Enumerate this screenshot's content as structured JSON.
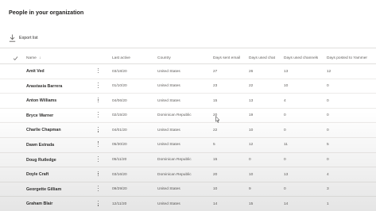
{
  "page": {
    "title": "People in your organization"
  },
  "toolbar": {
    "export_label": "Export list"
  },
  "table": {
    "columns": {
      "name": "Name",
      "last_active": "Last active",
      "country": "Country",
      "days_email": "Days sent email",
      "days_chat": "Days used chat",
      "days_channels": "Days used channels",
      "days_yammer": "Days posted to Yammer"
    },
    "rows": [
      {
        "name": "Amit Ved",
        "last_active": "03/18/20",
        "country": "United States",
        "email": "27",
        "chat": "26",
        "channels": "13",
        "yammer": "12"
      },
      {
        "name": "Anastasia Barrera",
        "last_active": "01/10/20",
        "country": "United States",
        "email": "23",
        "chat": "22",
        "channels": "10",
        "yammer": "0"
      },
      {
        "name": "Anton Williams",
        "last_active": "04/06/20",
        "country": "United States",
        "email": "15",
        "chat": "13",
        "channels": "4",
        "yammer": "0"
      },
      {
        "name": "Bryce Warner",
        "last_active": "02/15/20",
        "country": "Dominican Republic",
        "email": "20",
        "chat": "19",
        "channels": "0",
        "yammer": "0"
      },
      {
        "name": "Charlie Chapman",
        "last_active": "04/01/20",
        "country": "United States",
        "email": "22",
        "chat": "10",
        "channels": "0",
        "yammer": "0"
      },
      {
        "name": "Dawn Estrada",
        "last_active": "05/30/20",
        "country": "United States",
        "email": "5",
        "chat": "12",
        "channels": "11",
        "yammer": "5"
      },
      {
        "name": "Doug Rutledge",
        "last_active": "05/11/20",
        "country": "Dominican Republic",
        "email": "15",
        "chat": "0",
        "channels": "0",
        "yammer": "0"
      },
      {
        "name": "Doyle Craft",
        "last_active": "03/16/20",
        "country": "Dominican Republic",
        "email": "20",
        "chat": "10",
        "channels": "13",
        "yammer": "4"
      },
      {
        "name": "Georgette Gilliam",
        "last_active": "09/29/20",
        "country": "United States",
        "email": "10",
        "chat": "9",
        "channels": "0",
        "yammer": "3"
      },
      {
        "name": "Graham Blair",
        "last_active": "12/11/20",
        "country": "United States",
        "email": "14",
        "chat": "15",
        "channels": "14",
        "yammer": "1"
      }
    ]
  },
  "icons": {
    "export": "download-icon",
    "select_all": "checkmark-icon",
    "sort": "sort-down-arrow",
    "row_menu": "more-vertical-icon"
  },
  "colors": {
    "text": "#323130",
    "muted": "#605e5c",
    "divider": "#edebe9"
  }
}
